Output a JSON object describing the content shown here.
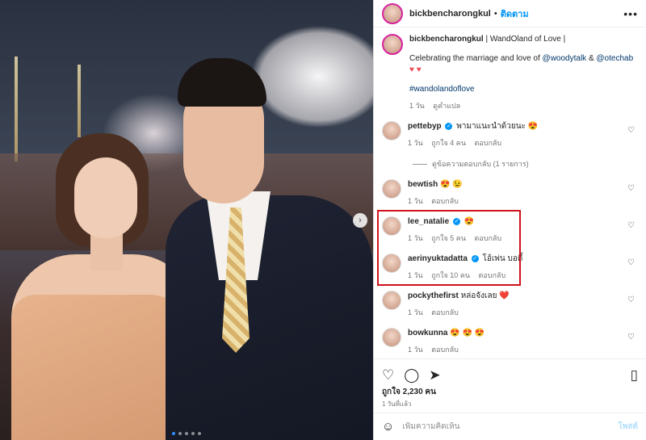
{
  "post": {
    "username": "bickbencharongkul",
    "follow_label": "ติดตาม",
    "separator": "•",
    "more_icon": "more-icon"
  },
  "caption": {
    "username": "bickbencharongkul",
    "title": "| WandOland of Love |",
    "line1_prefix": "Celebrating the marriage and love of",
    "mention1": "@woodytalk",
    "and": "&",
    "mention2": "@otechab",
    "hearts": "♥ ♥",
    "hashtag": "#wandolandoflove",
    "time": "1 วัน",
    "translate": "ดูคำแปล"
  },
  "comments": [
    {
      "username": "pettebyp",
      "verified": true,
      "text": "พามาแนะนำด้วยนะ 😍",
      "time": "1 วัน",
      "likes": "ถูกใจ 4 คน",
      "reply": "ตอบกลับ"
    },
    {
      "username": "bewtish",
      "verified": false,
      "text": "😍 😉",
      "time": "1 วัน",
      "likes": "",
      "reply": "ตอบกลับ"
    },
    {
      "username": "lee_natalie",
      "verified": true,
      "text": "😍",
      "time": "1 วัน",
      "likes": "ถูกใจ 5 คน",
      "reply": "ตอบกลับ"
    },
    {
      "username": "aerinyuktadatta",
      "verified": true,
      "text": "โอ้เพ่น บอดี้",
      "time": "1 วัน",
      "likes": "ถูกใจ 10 คน",
      "reply": "ตอบกลับ"
    },
    {
      "username": "pockythefirst",
      "verified": false,
      "text": "หล่อจังเลย ❤️",
      "time": "1 วัน",
      "likes": "",
      "reply": "ตอบกลับ"
    },
    {
      "username": "bowkunna",
      "verified": false,
      "text": "😍 😍 😍",
      "time": "1 วัน",
      "likes": "",
      "reply": "ตอบกลับ"
    }
  ],
  "view_replies": "ดูข้อความตอบกลับ (1 รายการ)",
  "likes_count": "ถูกใจ 2,230 คน",
  "posted": "1 วันที่แล้ว",
  "add_comment": {
    "placeholder": "เพิ่มความคิดเห็น",
    "post_label": "โพสต์"
  }
}
